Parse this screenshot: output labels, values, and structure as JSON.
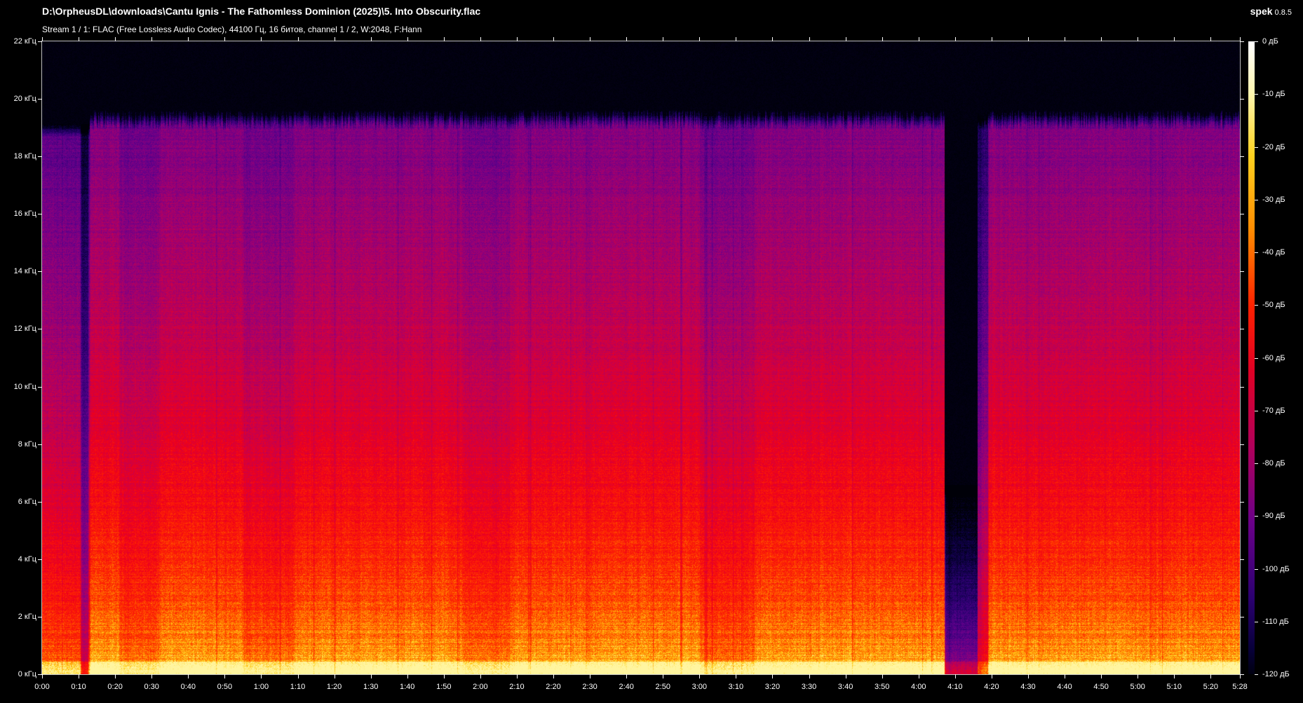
{
  "window": {
    "title": "D:\\OrpheusDL\\downloads\\Cantu Ignis - The Fathomless Dominion (2025)\\5. Into Obscurity.flac",
    "stream_info": "Stream 1 / 1: FLAC (Free Lossless Audio Codec), 44100 Гц, 16 битов, channel 1 / 2, W:2048, F:Hann",
    "app_name": "spek",
    "app_version": "0.8.5"
  },
  "spectrogram": {
    "freq_labels": [
      "0 кГц",
      "2 кГц",
      "4 кГц",
      "6 кГц",
      "8 кГц",
      "10 кГц",
      "12 кГц",
      "14 кГц",
      "16 кГц",
      "18 кГц",
      "20 кГц",
      "22 кГц"
    ],
    "time_labels": [
      "0:00",
      "0:10",
      "0:20",
      "0:30",
      "0:40",
      "0:50",
      "1:00",
      "1:10",
      "1:20",
      "1:30",
      "1:40",
      "1:50",
      "2:00",
      "2:10",
      "2:20",
      "2:30",
      "2:40",
      "2:50",
      "3:00",
      "3:10",
      "3:20",
      "3:30",
      "3:40",
      "3:50",
      "4:00",
      "4:10",
      "4:20",
      "4:30",
      "4:40",
      "4:50",
      "5:00",
      "5:10",
      "5:20",
      "5:28"
    ],
    "db_labels": [
      "0 дБ",
      "-10 дБ",
      "-20 дБ",
      "-30 дБ",
      "-40 дБ",
      "-50 дБ",
      "-60 дБ",
      "-70 дБ",
      "-80 дБ",
      "-90 дБ",
      "-100 дБ",
      "-110 дБ",
      "-120 дБ"
    ],
    "duration_seconds": 328,
    "max_frequency_khz": 22,
    "sample_rate_hz": 44100,
    "colors": {
      "background": "#000000",
      "text": "#ffffff",
      "frame": "#bfbfbf"
    }
  }
}
